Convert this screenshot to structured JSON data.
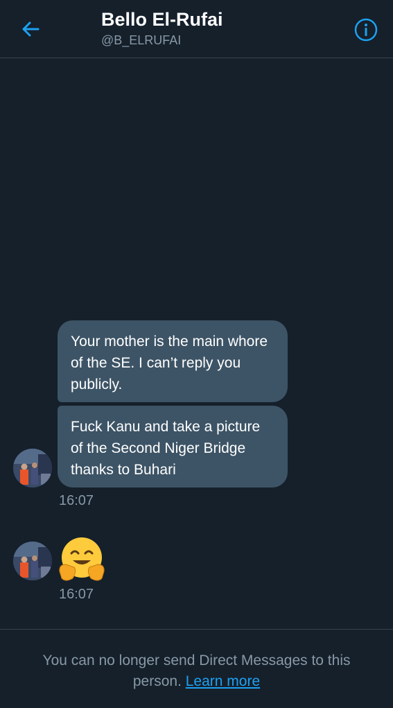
{
  "header": {
    "title": "Bello El-Rufai",
    "handle": "@B_ELRUFAI",
    "back_icon": "arrow-left-icon",
    "info_icon": "info-icon"
  },
  "messages": [
    {
      "text": "Your mother is the main whore of the SE. I can’t reply you publicly."
    },
    {
      "text": "Fuck Kanu and take a picture of the Second Niger Bridge thanks to Buhari"
    }
  ],
  "timestamps": [
    "16:07",
    "16:07"
  ],
  "emoji_message": {
    "icon": "hugging-face-emoji"
  },
  "footer": {
    "notice": "You can no longer send Direct Messages to this person.",
    "link": "Learn more"
  },
  "colors": {
    "background": "#15202b",
    "bubble": "#3d5466",
    "accent": "#1da1f2",
    "muted_text": "#8899a6",
    "divider": "#38444d"
  }
}
